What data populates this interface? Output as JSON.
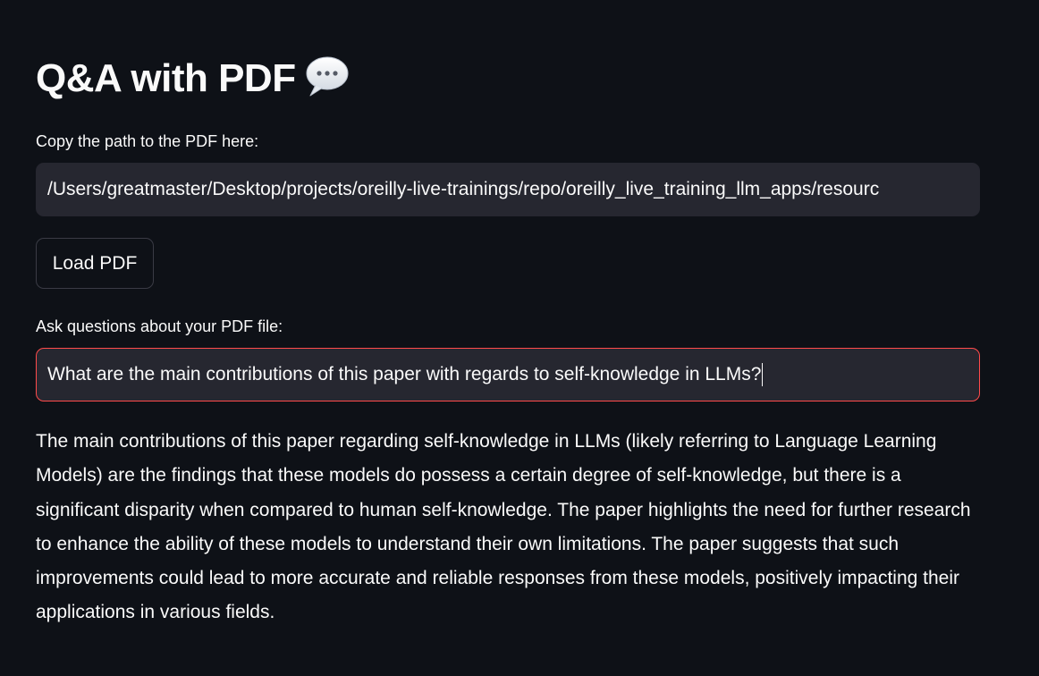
{
  "header": {
    "title": "Q&A with PDF",
    "title_icon": "speech-balloon-icon"
  },
  "pdf_path": {
    "label": "Copy the path to the PDF here:",
    "value": "/Users/greatmaster/Desktop/projects/oreilly-live-trainings/repo/oreilly_live_training_llm_apps/resourc"
  },
  "load_button": {
    "label": "Load PDF"
  },
  "question": {
    "label": "Ask questions about your PDF file:",
    "value": "What are the main contributions of this paper with regards to self-knowledge in LLMs?",
    "focus_color": "#ff4b4b"
  },
  "answer": {
    "text": "The main contributions of this paper regarding self-knowledge in LLMs (likely referring to Language Learning Models) are the findings that these models do possess a certain degree of self-knowledge, but there is a significant disparity when compared to human self-knowledge. The paper highlights the need for further research to enhance the ability of these models to understand their own limitations. The paper suggests that such improvements could lead to more accurate and reliable responses from these models, positively impacting their applications in various fields."
  },
  "theme": {
    "background": "#0e1117",
    "input_background": "#262730",
    "text": "#fafafa"
  }
}
